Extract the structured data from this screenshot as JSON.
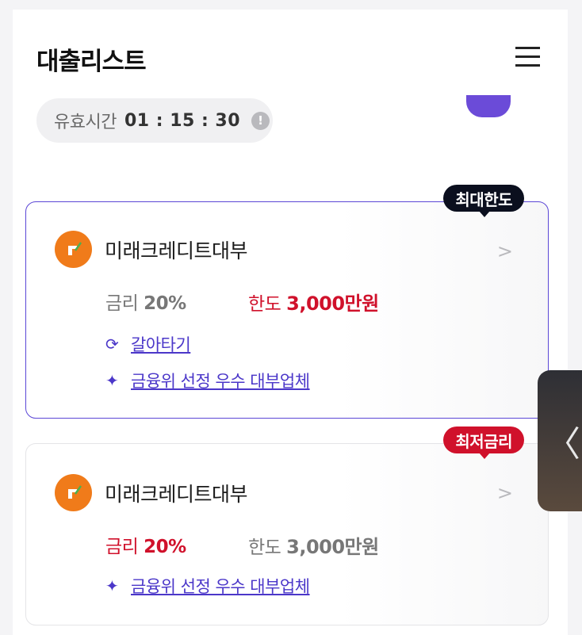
{
  "header": {
    "title": "대출리스트"
  },
  "timer": {
    "label": "유효시간",
    "value": "01 : 15 : 30"
  },
  "loans": [
    {
      "badge": "최대한도",
      "lender": "미래크레디트대부",
      "rate_label": "금리",
      "rate_value": "20%",
      "limit_label": "한도",
      "limit_value": "3,000만원",
      "links": [
        "갈아타기",
        "금융위 선정 우수 대부업체"
      ]
    },
    {
      "badge": "최저금리",
      "lender": "미래크레디트대부",
      "rate_label": "금리",
      "rate_value": "20%",
      "limit_label": "한도",
      "limit_value": "3,000만원",
      "links": [
        "금융위 선정 우수 대부업체"
      ]
    }
  ],
  "colors": {
    "accent": "#5b47d6",
    "red": "#d0112b",
    "dark_badge": "#0b0f1e",
    "logo": "#f07b1a"
  },
  "icons": {
    "menu": "hamburger-icon",
    "info": "exclamation-circle-icon",
    "refresh": "refresh-icon",
    "sparkle": "sparkle-icon",
    "chevron": "chevron-right-icon",
    "side_tab": "chevron-left-icon"
  }
}
